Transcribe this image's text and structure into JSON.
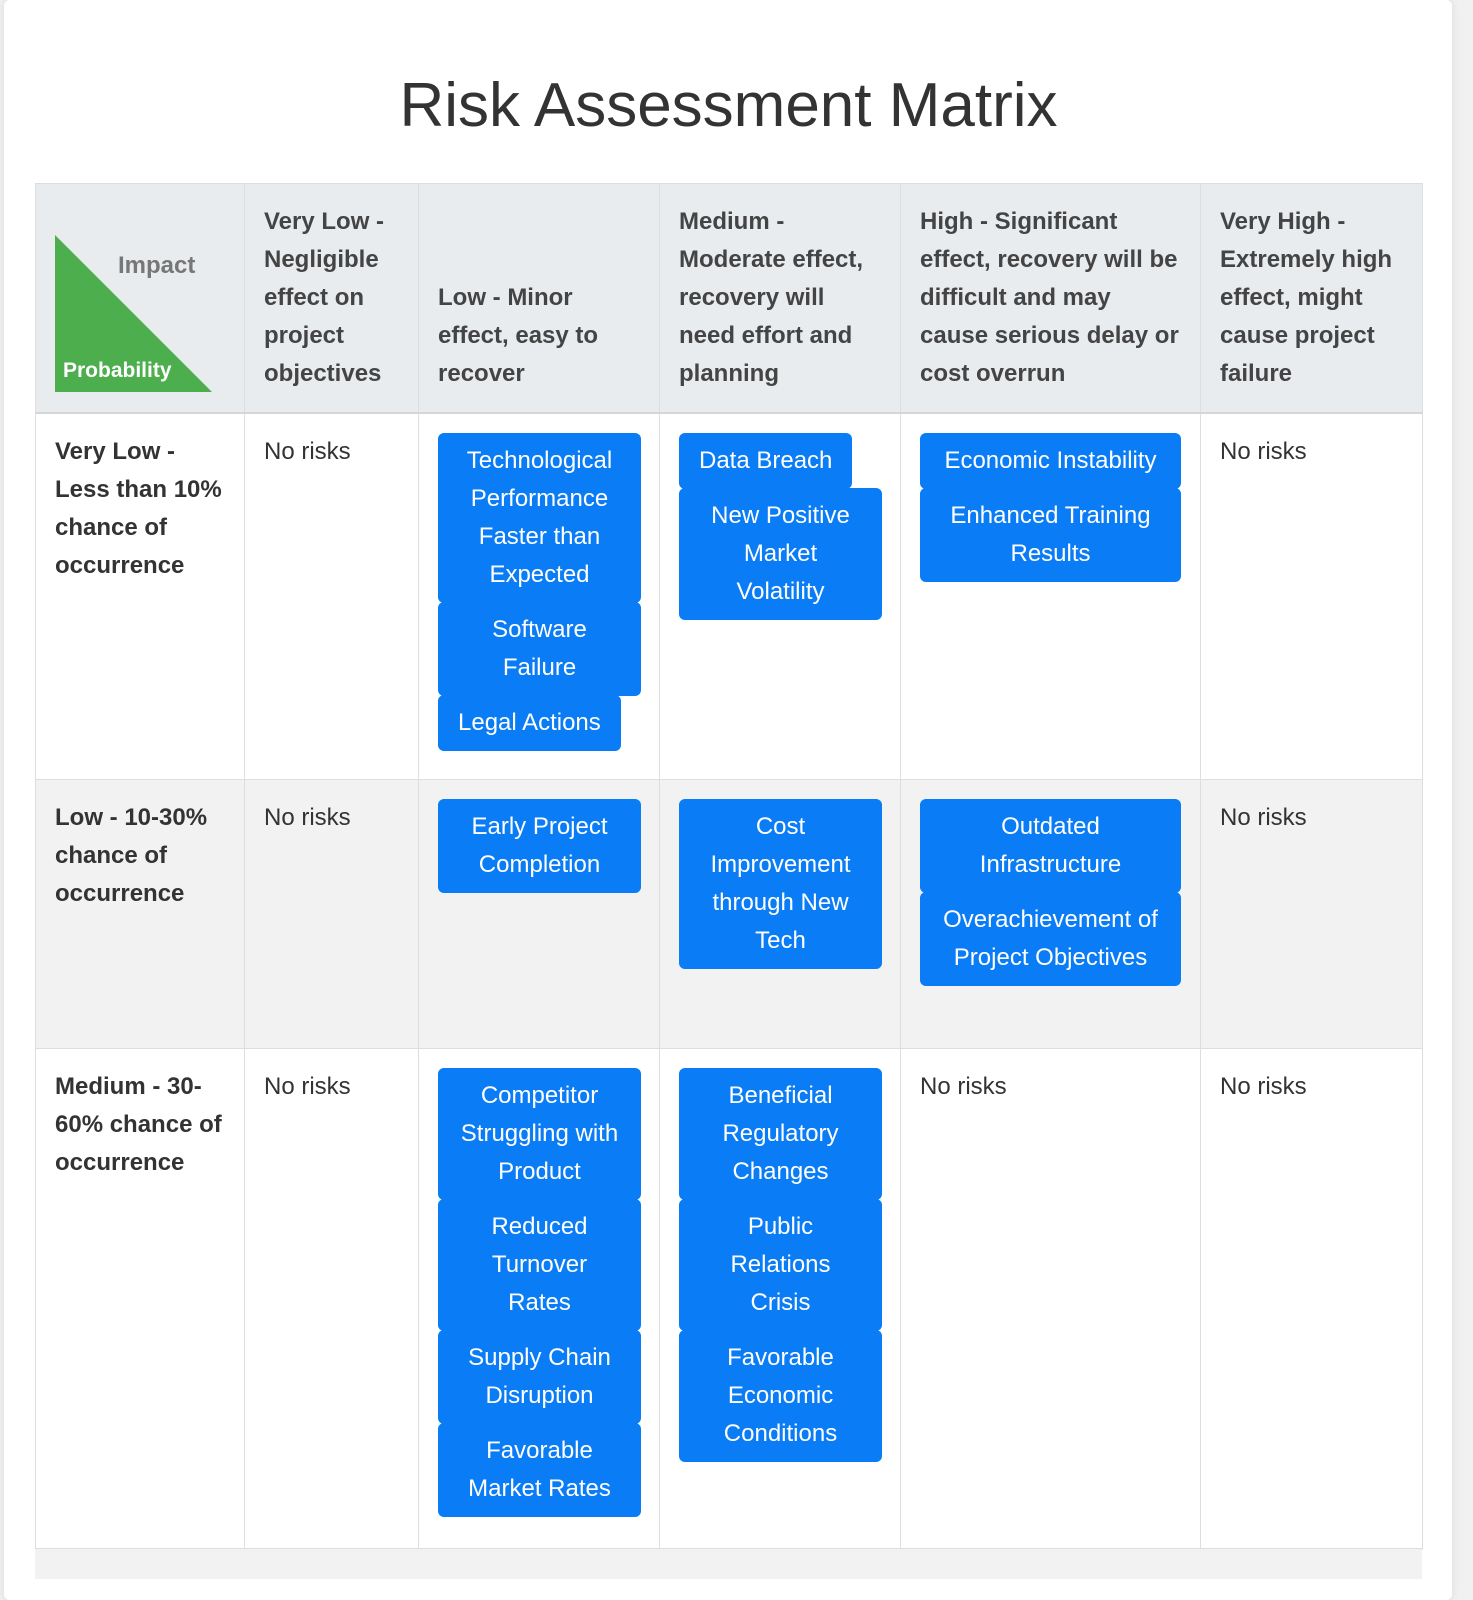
{
  "title": "Risk Assessment Matrix",
  "corner": {
    "impact": "Impact",
    "probability": "Probability"
  },
  "accent_green": "#4cae4c",
  "risk_button_color": "#0a7cf5",
  "impact_levels": [
    "Very Low - Negligible effect on project objectives",
    "Low - Minor effect, easy to recover",
    "Medium - Moderate effect, recovery will need effort and planning",
    "High - Significant effect, recovery will be difficult and may cause serious delay or cost overrun",
    "Very High - Extremely high effect, might cause project failure"
  ],
  "rows": [
    {
      "probability": "Very Low - Less than 10% chance of occurrence",
      "cells": [
        {
          "empty": "No risks",
          "risks": []
        },
        {
          "risks": [
            "Technological Performance Faster than Expected",
            "Software Failure",
            "Legal Actions"
          ]
        },
        {
          "risks": [
            "Data Breach",
            "New Positive Market Volatility"
          ]
        },
        {
          "risks": [
            "Economic Instability",
            "Enhanced Training Results"
          ]
        },
        {
          "empty": "No risks",
          "risks": []
        }
      ]
    },
    {
      "probability": "Low - 10-30% chance of occurrence",
      "cells": [
        {
          "empty": "No risks",
          "risks": []
        },
        {
          "risks": [
            "Early Project Completion"
          ]
        },
        {
          "risks": [
            "Cost Improvement through New Tech"
          ]
        },
        {
          "risks": [
            "Outdated Infrastructure",
            "Overachievement of Project Objectives"
          ]
        },
        {
          "empty": "No risks",
          "risks": []
        }
      ]
    },
    {
      "probability": "Medium - 30-60% chance of occurrence",
      "cells": [
        {
          "empty": "No risks",
          "risks": []
        },
        {
          "risks": [
            "Competitor Struggling with Product",
            "Reduced Turnover Rates",
            "Supply Chain Disruption",
            "Favorable Market Rates"
          ]
        },
        {
          "risks": [
            "Beneficial Regulatory Changes",
            "Public Relations Crisis",
            "Favorable Economic Conditions"
          ]
        },
        {
          "empty": "No risks",
          "risks": []
        },
        {
          "empty": "No risks",
          "risks": []
        }
      ]
    }
  ]
}
